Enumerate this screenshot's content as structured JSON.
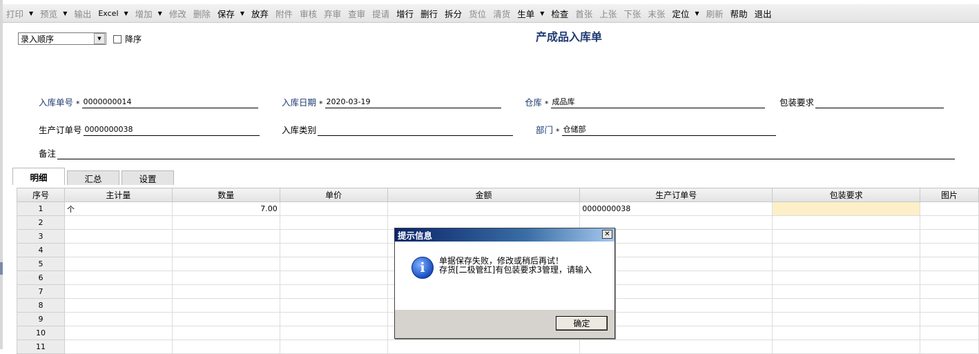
{
  "toolbar": [
    {
      "label": "打印",
      "enabled": false,
      "dropdown": true
    },
    {
      "label": "预览",
      "enabled": false,
      "dropdown": true
    },
    {
      "label": "输出",
      "enabled": false,
      "dropdown": false
    },
    {
      "label": "Excel",
      "enabled": true,
      "dropdown": true
    },
    {
      "label": "增加",
      "enabled": false,
      "dropdown": true
    },
    {
      "label": "修改",
      "enabled": false,
      "dropdown": false
    },
    {
      "label": "删除",
      "enabled": false,
      "dropdown": false
    },
    {
      "label": "保存",
      "enabled": true,
      "dropdown": true
    },
    {
      "label": "放弃",
      "enabled": true,
      "dropdown": false
    },
    {
      "label": "附件",
      "enabled": false,
      "dropdown": false
    },
    {
      "label": "审核",
      "enabled": false,
      "dropdown": false
    },
    {
      "label": "弃审",
      "enabled": false,
      "dropdown": false
    },
    {
      "label": "查审",
      "enabled": false,
      "dropdown": false
    },
    {
      "label": "提请",
      "enabled": false,
      "dropdown": false
    },
    {
      "label": "增行",
      "enabled": true,
      "dropdown": false
    },
    {
      "label": "删行",
      "enabled": true,
      "dropdown": false
    },
    {
      "label": "拆分",
      "enabled": true,
      "dropdown": false
    },
    {
      "label": "货位",
      "enabled": false,
      "dropdown": false
    },
    {
      "label": "清货",
      "enabled": false,
      "dropdown": false
    },
    {
      "label": "生单",
      "enabled": true,
      "dropdown": true
    },
    {
      "label": "检查",
      "enabled": true,
      "dropdown": false
    },
    {
      "label": "首张",
      "enabled": false,
      "dropdown": false
    },
    {
      "label": "上张",
      "enabled": false,
      "dropdown": false
    },
    {
      "label": "下张",
      "enabled": false,
      "dropdown": false
    },
    {
      "label": "末张",
      "enabled": false,
      "dropdown": false
    },
    {
      "label": "定位",
      "enabled": true,
      "dropdown": true
    },
    {
      "label": "刷新",
      "enabled": false,
      "dropdown": false
    },
    {
      "label": "帮助",
      "enabled": true,
      "dropdown": false
    },
    {
      "label": "退出",
      "enabled": true,
      "dropdown": false
    }
  ],
  "sort": {
    "value": "录入顺序",
    "desc_label": "降序"
  },
  "title": "产成品入库单",
  "fields": {
    "receipt_no": {
      "label": "入库单号",
      "value": "0000000014"
    },
    "receipt_date": {
      "label": "入库日期",
      "value": "2020-03-19"
    },
    "warehouse": {
      "label": "仓库",
      "value": "成品库"
    },
    "packing": {
      "label": "包装要求",
      "value": ""
    },
    "prod_order": {
      "label": "生产订单号",
      "value": "0000000038"
    },
    "receipt_type": {
      "label": "入库类别",
      "value": ""
    },
    "department": {
      "label": "部门",
      "value": "仓储部"
    },
    "remark": {
      "label": "备注",
      "value": ""
    }
  },
  "required_mark": "*",
  "tabs": [
    "明细",
    "汇总",
    "设置"
  ],
  "grid": {
    "columns": [
      "序号",
      "主计量",
      "数量",
      "单价",
      "金额",
      "生产订单号",
      "包装要求",
      "图片"
    ],
    "rows": [
      [
        "1",
        "个",
        "7.00",
        "",
        "",
        "0000000038",
        "",
        ""
      ],
      [
        "2",
        "",
        "",
        "",
        "",
        "",
        "",
        ""
      ],
      [
        "3",
        "",
        "",
        "",
        "",
        "",
        "",
        ""
      ],
      [
        "4",
        "",
        "",
        "",
        "",
        "",
        "",
        ""
      ],
      [
        "5",
        "",
        "",
        "",
        "",
        "",
        "",
        ""
      ],
      [
        "6",
        "",
        "",
        "",
        "",
        "",
        "",
        ""
      ],
      [
        "7",
        "",
        "",
        "",
        "",
        "",
        "",
        ""
      ],
      [
        "8",
        "",
        "",
        "",
        "",
        "",
        "",
        ""
      ],
      [
        "9",
        "",
        "",
        "",
        "",
        "",
        "",
        ""
      ],
      [
        "10",
        "",
        "",
        "",
        "",
        "",
        "",
        ""
      ],
      [
        "11",
        "",
        "",
        "",
        "",
        "",
        "",
        ""
      ]
    ]
  },
  "dialog": {
    "title": "提示信息",
    "close": "✕",
    "icon": "info-icon",
    "icon_glyph": "i",
    "lines": [
      "单据保存失败，修改或稍后再试！",
      "存货[二极管红]有包装要求3管理，请输入"
    ],
    "ok": "确定"
  }
}
